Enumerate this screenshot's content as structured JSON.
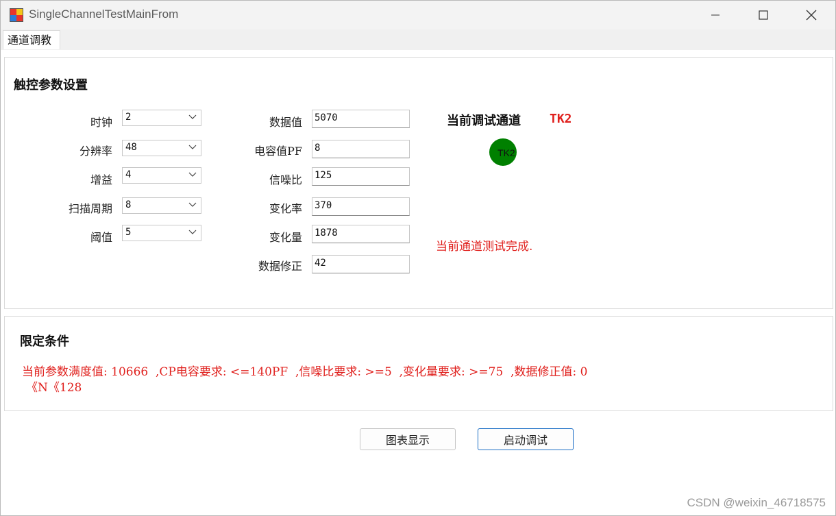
{
  "window": {
    "title": "SingleChannelTestMainFrom"
  },
  "tabs": [
    {
      "label": "通道调教"
    }
  ],
  "touch_params": {
    "title": "触控参数设置",
    "combos": [
      {
        "label": "时钟",
        "value": "2"
      },
      {
        "label": "分辨率",
        "value": "48"
      },
      {
        "label": "增益",
        "value": "4"
      },
      {
        "label": "扫描周期",
        "value": "8"
      },
      {
        "label": "阈值",
        "value": "5"
      }
    ],
    "fields": [
      {
        "label": "数据值",
        "value": "5070"
      },
      {
        "label": "电容值PF",
        "value": "8"
      },
      {
        "label": "信噪比",
        "value": "125"
      },
      {
        "label": "变化率",
        "value": "370"
      },
      {
        "label": "变化量",
        "value": "1878"
      },
      {
        "label": "数据修正",
        "value": "42"
      }
    ],
    "current_channel_label": "当前调试通道",
    "current_channel_value": "TK2",
    "indicator_text": "TK2",
    "indicator_color": "#008000",
    "status_message": "当前通道测试完成."
  },
  "limits": {
    "title": "限定条件",
    "line1": "当前参数满度值: 10666  ,CP电容要求: <=140PF  ,信噪比要求: >=5  ,变化量要求: >=75  ,数据修正值: 0",
    "line2": "《N《128"
  },
  "buttons": {
    "chart": "图表显示",
    "start": "启动调试"
  },
  "watermark": "CSDN @weixin_46718575",
  "colors": {
    "accent_red": "#e0201d",
    "primary_border": "#1a6dc5"
  }
}
